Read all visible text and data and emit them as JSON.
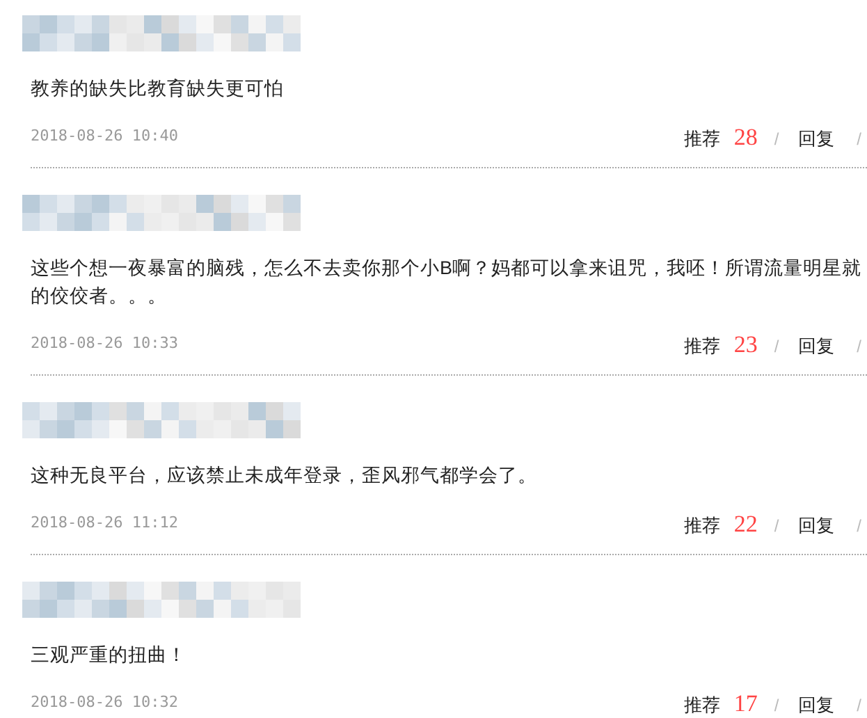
{
  "comments": [
    {
      "lines": [
        "教养的缺失比教育缺失更可怕"
      ],
      "time": "2018-08-26 10:40",
      "recommend_label": "推荐",
      "recommend_count": "28",
      "reply_label": "回复",
      "separators": [
        "/",
        "/"
      ]
    },
    {
      "lines": [
        "这些个想一夜暴富的脑残，怎么不去卖你那个小B啊？妈都可以拿来诅咒，我呸！所谓流量明星就",
        "的佼佼者。。。"
      ],
      "time": "2018-08-26 10:33",
      "recommend_label": "推荐",
      "recommend_count": "23",
      "reply_label": "回复",
      "separators": [
        "/",
        "/"
      ]
    },
    {
      "lines": [
        "这种无良平台，应该禁止未成年登录，歪风邪气都学会了。"
      ],
      "time": "2018-08-26 11:12",
      "recommend_label": "推荐",
      "recommend_count": "22",
      "reply_label": "回复",
      "separators": [
        "/",
        "/"
      ]
    },
    {
      "lines": [
        "三观严重的扭曲！"
      ],
      "time": "2018-08-26 10:32",
      "recommend_label": "推荐",
      "recommend_count": "17",
      "reply_label": "回复",
      "separators": [
        "/",
        "/"
      ]
    }
  ]
}
